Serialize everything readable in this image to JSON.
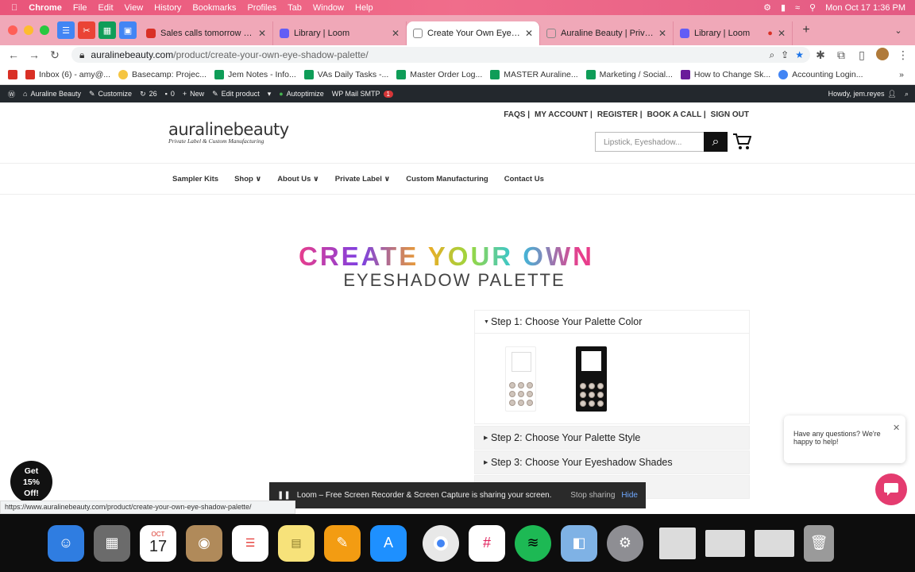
{
  "menubar": {
    "app": "Chrome",
    "items": [
      "File",
      "Edit",
      "View",
      "History",
      "Bookmarks",
      "Profiles",
      "Tab",
      "Window",
      "Help"
    ],
    "clock": "Mon Oct 17  1:36 PM"
  },
  "tabs": [
    {
      "title": "Sales calls tomorrow - am",
      "favicon": "gmail-icon",
      "color": "#d93025"
    },
    {
      "title": "Library | Loom",
      "favicon": "loom-icon",
      "color": "#625df5"
    },
    {
      "title": "Create Your Own Eye Shad",
      "favicon": "auraline-icon",
      "color": "#888888",
      "active": true
    },
    {
      "title": "Auraline Beauty | Private L",
      "favicon": "auraline-icon",
      "color": "#888888"
    },
    {
      "title": "Library | Loom",
      "favicon": "loom-icon",
      "color": "#625df5"
    }
  ],
  "address": {
    "host": "auralinebeauty.com",
    "path": "/product/create-your-own-eye-shadow-palette/"
  },
  "bookmarks": [
    {
      "label": "",
      "color": "#d93025"
    },
    {
      "label": "Inbox (6) - amy@...",
      "color": "#d93025"
    },
    {
      "label": "Basecamp: Projec...",
      "color": "#f5c542"
    },
    {
      "label": "Jem Notes - Info...",
      "color": "#0f9d58"
    },
    {
      "label": "VAs Daily Tasks -...",
      "color": "#0f9d58"
    },
    {
      "label": "Master Order Log...",
      "color": "#0f9d58"
    },
    {
      "label": "MASTER Auraline...",
      "color": "#0f9d58"
    },
    {
      "label": "Marketing / Social...",
      "color": "#0f9d58"
    },
    {
      "label": "How to Change Sk...",
      "color": "#6a1b9a"
    },
    {
      "label": "Accounting Login...",
      "color": "#4285f4"
    }
  ],
  "wpbar": {
    "site": "Auraline Beauty",
    "customize": "Customize",
    "updates": "26",
    "comments": "0",
    "new": "New",
    "edit": "Edit product",
    "autoptimize": "Autoptimize",
    "smtp": "WP Mail SMTP",
    "smtp_badge": "1",
    "howdy": "Howdy, jem.reyes"
  },
  "site": {
    "logo_main": "auralinebeauty",
    "logo_tag": "Private Label & Custom Manufacturing",
    "top_links": [
      "FAQS |",
      "MY ACCOUNT |",
      "REGISTER |",
      "BOOK A CALL |",
      "SIGN OUT"
    ],
    "search_placeholder": "Lipstick, Eyeshadow...",
    "nav": [
      "Sampler Kits",
      "Shop ∨",
      "About Us ∨",
      "Private Label ∨",
      "Custom Manufacturing",
      "Contact Us"
    ],
    "heading": "CREATE YOUR OWN",
    "subheading": "EYESHADOW PALETTE",
    "steps": [
      "Step 1: Choose Your Palette Color",
      "Step 2: Choose Your Palette Style",
      "Step 3: Choose Your Eyeshadow Shades"
    ],
    "chat_text": "Have any questions? We're happy to help!",
    "promo": [
      "Get",
      "15%",
      "Off!"
    ]
  },
  "loom": {
    "message": "Loom – Free Screen Recorder & Screen Capture is sharing your screen.",
    "stop": "Stop sharing",
    "hide": "Hide"
  },
  "status_url": "https://www.auralinebeauty.com/product/create-your-own-eye-shadow-palette/",
  "dock": [
    {
      "name": "finder-icon",
      "color": "#2f7de1"
    },
    {
      "name": "launchpad-icon",
      "color": "#6b6b6b"
    },
    {
      "name": "calendar-icon",
      "color": "#ffffff",
      "month": "OCT",
      "day": "17"
    },
    {
      "name": "contacts-icon",
      "color": "#b08a5a"
    },
    {
      "name": "reminders-icon",
      "color": "#ffffff"
    },
    {
      "name": "notes-icon",
      "color": "#f7e27a"
    },
    {
      "name": "pages-icon",
      "color": "#f39c12"
    },
    {
      "name": "appstore-icon",
      "color": "#1e90ff"
    },
    {
      "name": "chrome-icon",
      "color": "#e8e8e8"
    },
    {
      "name": "slack-icon",
      "color": "#ffffff"
    },
    {
      "name": "spotify-icon",
      "color": "#1db954"
    },
    {
      "name": "preview-icon",
      "color": "#7fb2e5"
    },
    {
      "name": "settings-icon",
      "color": "#8e8e93"
    },
    {
      "name": "window-thumb-icon",
      "color": "#dcdcdc"
    },
    {
      "name": "window-thumb-icon",
      "color": "#dcdcdc"
    },
    {
      "name": "window-thumb-icon",
      "color": "#dcdcdc"
    },
    {
      "name": "trash-icon",
      "color": "#9a9a9a"
    }
  ]
}
